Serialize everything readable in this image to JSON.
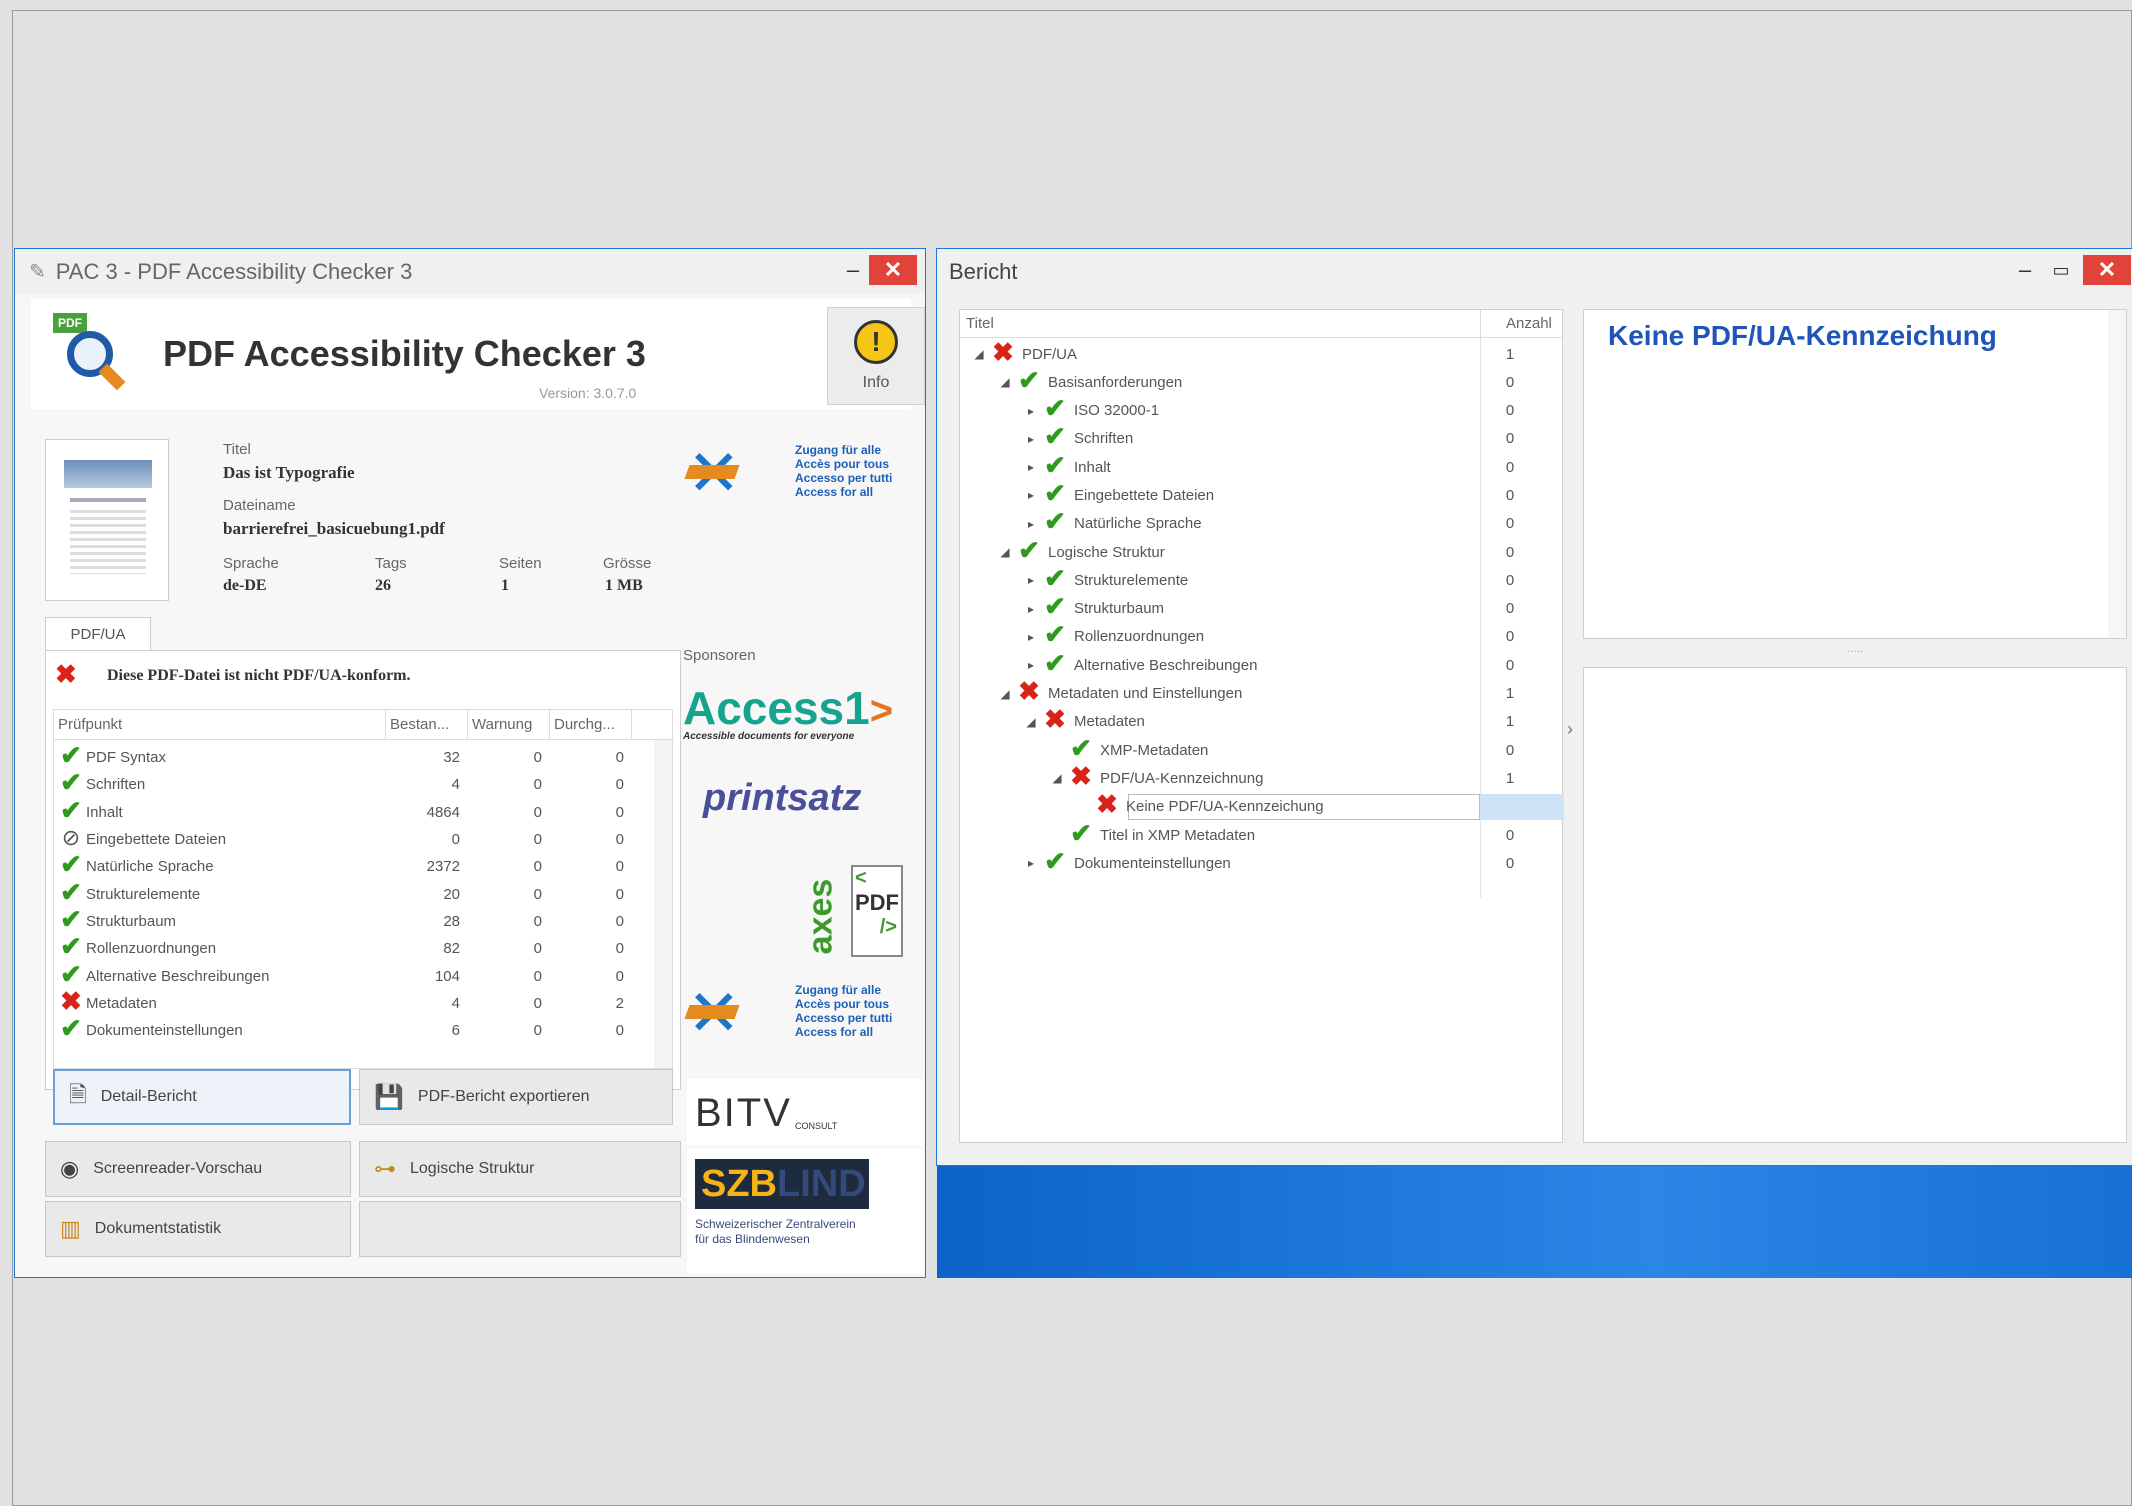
{
  "pac": {
    "window_title": "PAC 3 - PDF Accessibility Checker 3",
    "app_name": "PDF Accessibility Checker 3",
    "version": "Version: 3.0.7.0",
    "info_label": "Info",
    "doc": {
      "title_label": "Titel",
      "title_value": "Das ist Typografie",
      "filename_label": "Dateiname",
      "filename_value": "barrierefrei_basicuebung1.pdf",
      "lang_label": "Sprache",
      "lang_value": "de-DE",
      "tags_label": "Tags",
      "tags_value": "26",
      "pages_label": "Seiten",
      "pages_value": "1",
      "size_label": "Grösse",
      "size_value": "1 MB"
    },
    "tab_label": "PDF/UA",
    "status_message": "Diese PDF-Datei ist nicht PDF/UA-konform.",
    "columns": [
      "Prüfpunkt",
      "Bestan...",
      "Warnung",
      "Durchg..."
    ],
    "rows": [
      {
        "status": "ok",
        "name": "PDF Syntax",
        "passed": "32",
        "warn": "0",
        "fail": "0"
      },
      {
        "status": "ok",
        "name": "Schriften",
        "passed": "4",
        "warn": "0",
        "fail": "0"
      },
      {
        "status": "ok",
        "name": "Inhalt",
        "passed": "4864",
        "warn": "0",
        "fail": "0"
      },
      {
        "status": "na",
        "name": "Eingebettete Dateien",
        "passed": "0",
        "warn": "0",
        "fail": "0"
      },
      {
        "status": "ok",
        "name": "Natürliche Sprache",
        "passed": "2372",
        "warn": "0",
        "fail": "0"
      },
      {
        "status": "ok",
        "name": "Strukturelemente",
        "passed": "20",
        "warn": "0",
        "fail": "0"
      },
      {
        "status": "ok",
        "name": "Strukturbaum",
        "passed": "28",
        "warn": "0",
        "fail": "0"
      },
      {
        "status": "ok",
        "name": "Rollenzuordnungen",
        "passed": "82",
        "warn": "0",
        "fail": "0"
      },
      {
        "status": "ok",
        "name": "Alternative Beschreibungen",
        "passed": "104",
        "warn": "0",
        "fail": "0"
      },
      {
        "status": "bad",
        "name": "Metadaten",
        "passed": "4",
        "warn": "0",
        "fail": "2"
      },
      {
        "status": "ok",
        "name": "Dokumenteinstellungen",
        "passed": "6",
        "warn": "0",
        "fail": "0"
      }
    ],
    "buttons": {
      "detail": "Detail-Bericht",
      "export": "PDF-Bericht exportieren",
      "screenreader": "Screenreader-Vorschau",
      "structure": "Logische Struktur",
      "stats": "Dokumentstatistik"
    },
    "sponsors_label": "Sponsoren",
    "access_for_all": [
      "Zugang für alle",
      "Accès pour tous",
      "Accesso per tutti",
      "Access for all"
    ],
    "access1": {
      "name": "Access1",
      "tagline": "Accessible documents for everyone"
    },
    "printsatz": "printsatz",
    "axes": {
      "name": "axes",
      "pdf": "PDF"
    },
    "bitv": {
      "name": "BITV",
      "suffix": "CONSULT"
    },
    "szb": {
      "name_a": "SZB",
      "name_b": "LIND",
      "tagline": [
        "Schweizerischer Zentralverein",
        "für das Blindenwesen"
      ]
    }
  },
  "bericht": {
    "window_title": "Bericht",
    "col_title": "Titel",
    "col_count": "Anzahl",
    "tree": [
      {
        "level": 0,
        "twisty": "◢",
        "status": "bad",
        "label": "PDF/UA",
        "count": "1"
      },
      {
        "level": 1,
        "twisty": "◢",
        "status": "ok",
        "label": "Basisanforderungen",
        "count": "0"
      },
      {
        "level": 2,
        "twisty": "▸",
        "status": "ok",
        "label": "ISO 32000-1",
        "count": "0"
      },
      {
        "level": 2,
        "twisty": "▸",
        "status": "ok",
        "label": "Schriften",
        "count": "0"
      },
      {
        "level": 2,
        "twisty": "▸",
        "status": "ok",
        "label": "Inhalt",
        "count": "0"
      },
      {
        "level": 2,
        "twisty": "▸",
        "status": "ok",
        "label": "Eingebettete Dateien",
        "count": "0"
      },
      {
        "level": 2,
        "twisty": "▸",
        "status": "ok",
        "label": "Natürliche Sprache",
        "count": "0"
      },
      {
        "level": 1,
        "twisty": "◢",
        "status": "ok",
        "label": "Logische Struktur",
        "count": "0"
      },
      {
        "level": 2,
        "twisty": "▸",
        "status": "ok",
        "label": "Strukturelemente",
        "count": "0"
      },
      {
        "level": 2,
        "twisty": "▸",
        "status": "ok",
        "label": "Strukturbaum",
        "count": "0"
      },
      {
        "level": 2,
        "twisty": "▸",
        "status": "ok",
        "label": "Rollenzuordnungen",
        "count": "0"
      },
      {
        "level": 2,
        "twisty": "▸",
        "status": "ok",
        "label": "Alternative Beschreibungen",
        "count": "0"
      },
      {
        "level": 1,
        "twisty": "◢",
        "status": "bad",
        "label": "Metadaten und Einstellungen",
        "count": "1"
      },
      {
        "level": 2,
        "twisty": "◢",
        "status": "bad",
        "label": "Metadaten",
        "count": "1"
      },
      {
        "level": 3,
        "twisty": "",
        "status": "ok",
        "label": "XMP-Metadaten",
        "count": "0"
      },
      {
        "level": 3,
        "twisty": "◢",
        "status": "bad",
        "label": "PDF/UA-Kennzeichnung",
        "count": "1"
      },
      {
        "level": 4,
        "twisty": "",
        "status": "bad",
        "label": "Keine PDF/UA-Kennzeichung",
        "count": "",
        "selected": true
      },
      {
        "level": 3,
        "twisty": "",
        "status": "ok",
        "label": "Titel in XMP Metadaten",
        "count": "0"
      },
      {
        "level": 2,
        "twisty": "▸",
        "status": "ok",
        "label": "Dokumenteinstellungen",
        "count": "0"
      }
    ],
    "detail_title": "Keine PDF/UA-Kennzeichung",
    "accent": "#1f55b8"
  }
}
